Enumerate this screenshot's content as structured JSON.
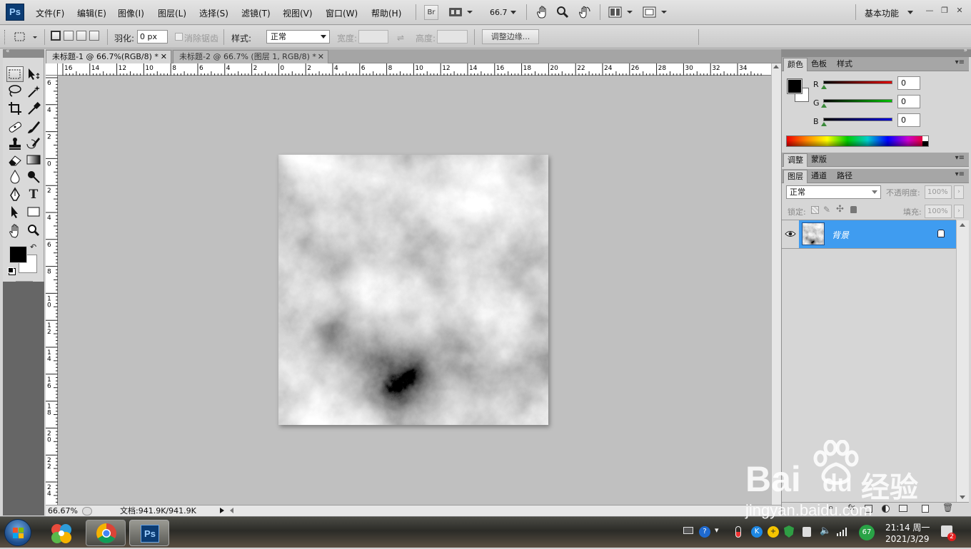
{
  "app": {
    "logo": "Ps"
  },
  "menu": [
    "文件(F)",
    "编辑(E)",
    "图像(I)",
    "图层(L)",
    "选择(S)",
    "滤镜(T)",
    "视图(V)",
    "窗口(W)",
    "帮助(H)"
  ],
  "appbar": {
    "bridge": "Br",
    "zoom": "66.7",
    "workspace": "基本功能"
  },
  "options": {
    "feather_label": "羽化:",
    "feather_value": "0 px",
    "antialias_label": "消除锯齿",
    "style_label": "样式:",
    "style_value": "正常",
    "width_label": "宽度:",
    "height_label": "高度:",
    "refine_edge": "调整边缘..."
  },
  "documents": {
    "tabs": [
      {
        "title": "未标题-1 @ 66.7%(RGB/8) *",
        "active": true
      },
      {
        "title": "未标题-2 @ 66.7% (图层 1, RGB/8) *",
        "active": false
      }
    ],
    "hruler_labels": [
      "16",
      "14",
      "12",
      "10",
      "8",
      "6",
      "4",
      "2",
      "0",
      "2",
      "4",
      "6",
      "8",
      "10",
      "12",
      "14",
      "16",
      "18",
      "20",
      "22",
      "24",
      "26",
      "28",
      "30",
      "32",
      "34"
    ],
    "vruler_labels": [
      "6",
      "4",
      "2",
      "0",
      "2",
      "4",
      "6",
      "8",
      "10",
      "12",
      "14",
      "16",
      "18",
      "20",
      "22",
      "24"
    ]
  },
  "status": {
    "zoom": "66.67%",
    "doc": "文档:941.9K/941.9K"
  },
  "panels": {
    "color_tabs": [
      "颜色",
      "色板",
      "样式"
    ],
    "r_label": "R",
    "g_label": "G",
    "b_label": "B",
    "r_value": "0",
    "g_value": "0",
    "b_value": "0",
    "adjust_tabs": [
      "调整",
      "蒙版"
    ],
    "layer_tabs": [
      "图层",
      "通道",
      "路径"
    ],
    "blend_mode": "正常",
    "opacity_label": "不透明度:",
    "opacity_value": "100%",
    "lock_label": "锁定:",
    "fill_label": "填充:",
    "fill_value": "100%",
    "layers": [
      {
        "name": "背景",
        "locked": true,
        "visible": true,
        "selected": true
      }
    ]
  },
  "taskbar": {
    "time": "21:14 周一",
    "date": "2021/3/29",
    "badge": "67",
    "notif": "2"
  },
  "watermark": {
    "brand": "Bai",
    "du": "du",
    "jingyan": "经验",
    "url": "jingyan.baidu.com"
  },
  "colors": {
    "layer_selected": "#3f9cf0",
    "ps_blue": "#0b3c74",
    "canvas_bg": "#c0c0c0"
  }
}
